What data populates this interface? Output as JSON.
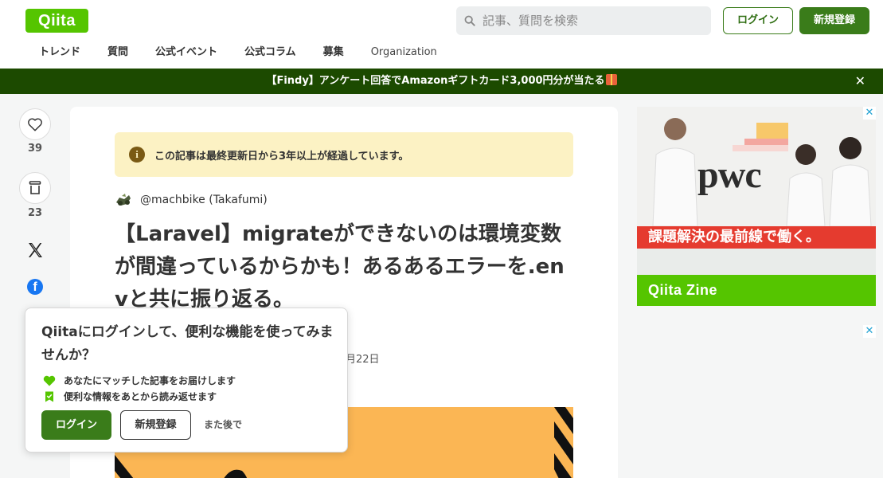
{
  "header": {
    "logo": "Qiita",
    "search_placeholder": "記事、質問を検索",
    "login_label": "ログイン",
    "signup_label": "新規登録"
  },
  "nav": {
    "items": [
      {
        "label": "トレンド"
      },
      {
        "label": "質問"
      },
      {
        "label": "公式イベント"
      },
      {
        "label": "公式コラム"
      },
      {
        "label": "募集"
      },
      {
        "label": "Organization"
      }
    ]
  },
  "banner": {
    "text": "【Findy】アンケート回答でAmazonギフトカード3,000円分が当たる",
    "close": "✕"
  },
  "sidebar": {
    "likes_count": "39",
    "stocks_count": "23"
  },
  "article": {
    "notice": "この記事は最終更新日から3年以上が経過しています。",
    "author": "@machbike (Takafumi)",
    "title": "【Laravel】migrateができないのは環境変数が間違っているからかも！あるあるエラーを.envと共に振り返る。",
    "date_partial": "月22日"
  },
  "ads": {
    "brand": "pwc",
    "caption": "課題解決の最前線で働く。",
    "footer": "Qiita Zine",
    "close": "✕"
  },
  "popup": {
    "title": "Qiitaにログインして、便利な機能を使ってみませんか？",
    "features": [
      {
        "text": "あなたにマッチした記事をお届けします"
      },
      {
        "text": "便利な情報をあとから読み返せます"
      }
    ],
    "login_label": "ログイン",
    "signup_label": "新規登録",
    "later_label": "また後で"
  },
  "colors": {
    "brand_green": "#55c500",
    "dark_green": "#3a7c1a",
    "banner_bg": "#1c4a00",
    "notice_bg": "#fcf2c4"
  }
}
